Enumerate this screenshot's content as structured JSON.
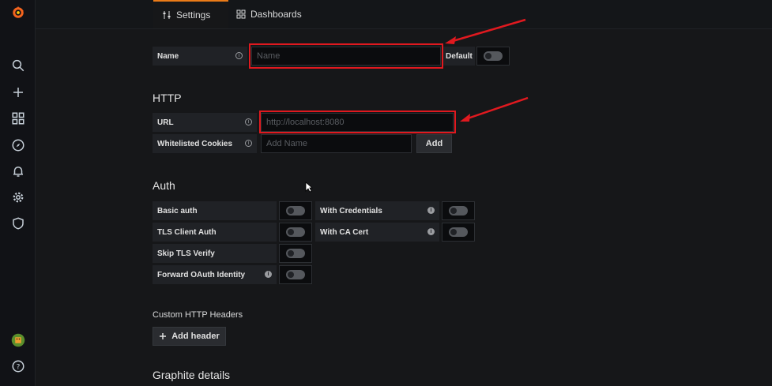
{
  "sidebar": {
    "icons": [
      "grafana-logo-icon",
      "search-icon",
      "plus-icon",
      "dashboards-grid-icon",
      "explore-compass-icon",
      "alerting-bell-icon",
      "configuration-gear-icon",
      "shield-icon",
      "user-avatar-icon",
      "help-icon"
    ]
  },
  "tabs": [
    {
      "label": "Settings",
      "active": true
    },
    {
      "label": "Dashboards",
      "active": false
    }
  ],
  "general": {
    "name_label": "Name",
    "name_placeholder": "Name",
    "default_label": "Default"
  },
  "http": {
    "title": "HTTP",
    "url_label": "URL",
    "url_placeholder": "http://localhost:8080",
    "cookies_label": "Whitelisted Cookies",
    "cookies_placeholder": "Add Name",
    "add_button": "Add"
  },
  "auth": {
    "title": "Auth",
    "basic_auth": "Basic auth",
    "with_credentials": "With Credentials",
    "tls_client_auth": "TLS Client Auth",
    "with_ca_cert": "With CA Cert",
    "skip_tls_verify": "Skip TLS Verify",
    "forward_oauth": "Forward OAuth Identity"
  },
  "headers": {
    "title": "Custom HTTP Headers",
    "add_header_button": "Add header"
  },
  "graphite": {
    "title": "Graphite details"
  },
  "colors": {
    "accent": "#eb7b18",
    "highlight": "#e0191f"
  }
}
